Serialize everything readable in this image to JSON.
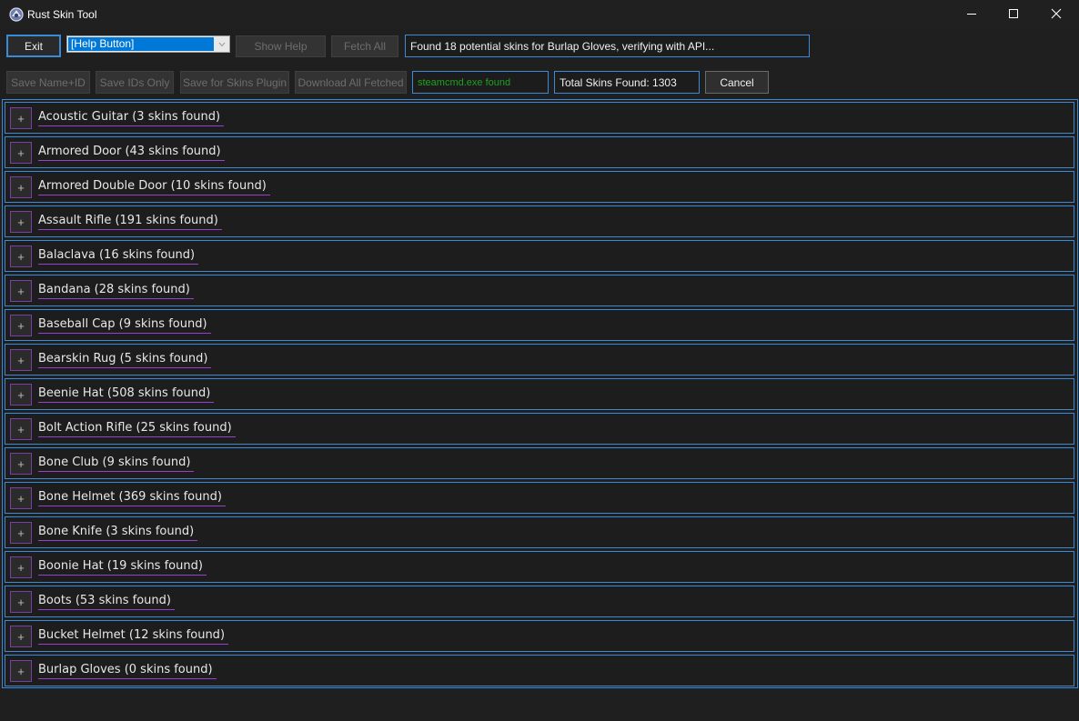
{
  "window": {
    "title": "Rust Skin Tool",
    "icon": "rust-app-icon",
    "controls": [
      "minimize-icon",
      "maximize-icon",
      "close-icon"
    ]
  },
  "toolbar": {
    "exit_label": "Exit",
    "help_select_value": "[Help Button]",
    "show_help_label": "Show Help",
    "fetch_all_label": "Fetch All",
    "status_message": "Found 18 potential skins for Burlap Gloves, verifying with API...",
    "save_name_id_label": "Save Name+ID",
    "save_ids_only_label": "Save IDs Only",
    "save_skins_plugin_label": "Save for Skins Plugin",
    "download_all_label": "Download All Fetched",
    "steamcmd_status": "steamcmd.exe found",
    "total_skins": "Total Skins Found: 1303",
    "cancel_label": "Cancel"
  },
  "colors": {
    "accent_blue": "#3c8ad6",
    "purple_underline": "#9b3fd0",
    "steamcmd_green": "#1fa01f",
    "background": "#1f1f1f"
  },
  "items": [
    {
      "expand": "+",
      "label": "Acoustic Guitar (3 skins found)"
    },
    {
      "expand": "+",
      "label": "Armored Door (43 skins found)"
    },
    {
      "expand": "+",
      "label": "Armored Double Door (10 skins found)"
    },
    {
      "expand": "+",
      "label": "Assault Rifle (191 skins found)"
    },
    {
      "expand": "+",
      "label": "Balaclava (16 skins found)"
    },
    {
      "expand": "+",
      "label": "Bandana (28 skins found)"
    },
    {
      "expand": "+",
      "label": "Baseball Cap (9 skins found)"
    },
    {
      "expand": "+",
      "label": "Bearskin Rug (5 skins found)"
    },
    {
      "expand": "+",
      "label": "Beenie Hat (508 skins found)"
    },
    {
      "expand": "+",
      "label": "Bolt Action Rifle (25 skins found)"
    },
    {
      "expand": "+",
      "label": "Bone Club (9 skins found)"
    },
    {
      "expand": "+",
      "label": "Bone Helmet (369 skins found)"
    },
    {
      "expand": "+",
      "label": "Bone Knife (3 skins found)"
    },
    {
      "expand": "+",
      "label": "Boonie Hat (19 skins found)"
    },
    {
      "expand": "+",
      "label": "Boots (53 skins found)"
    },
    {
      "expand": "+",
      "label": "Bucket Helmet (12 skins found)"
    },
    {
      "expand": "+",
      "label": "Burlap Gloves (0 skins found)"
    }
  ]
}
